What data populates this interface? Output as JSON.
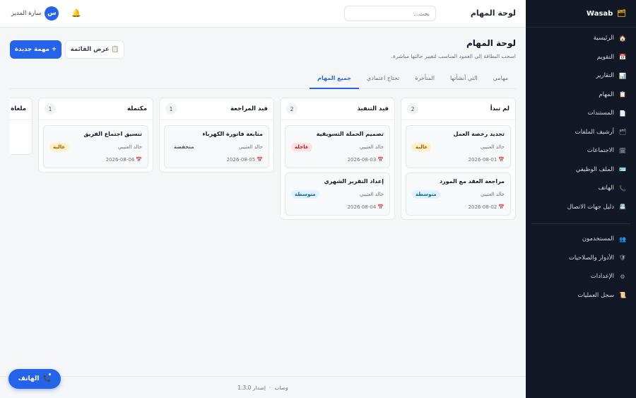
{
  "sidebar": {
    "brand": "Wasab",
    "brand_icon": "folder-icon",
    "items": [
      {
        "label": "الرئيسية",
        "icon": "🏠"
      },
      {
        "label": "التقويم",
        "icon": "📅"
      },
      {
        "label": "التقارير",
        "icon": "📊"
      },
      {
        "label": "المهام",
        "icon": "📋"
      },
      {
        "label": "المستندات",
        "icon": "📄"
      },
      {
        "label": "أرشيف الملفات",
        "icon": "🗂"
      },
      {
        "label": "الاجتماعات",
        "icon": "🗓"
      },
      {
        "label": "الملف الوظيفي",
        "icon": "🪪"
      },
      {
        "label": "الهاتف",
        "icon": "📞"
      },
      {
        "label": "دليل جهات الاتصال",
        "icon": "📇"
      }
    ],
    "admin_items": [
      {
        "label": "المستخدمون",
        "icon": "👥"
      },
      {
        "label": "الأدوار والصلاحيات",
        "icon": "🛡"
      },
      {
        "label": "الإعدادات",
        "icon": "⚙"
      },
      {
        "label": "سجل العمليات",
        "icon": "📜"
      }
    ]
  },
  "topbar": {
    "title": "لوحة المهام",
    "search_placeholder": "بحث...",
    "user_initial": "س",
    "user_name": "سارة المدير"
  },
  "header": {
    "title": "لوحة المهام",
    "subtitle": "اسحب البطاقة إلى العمود المناسب لتغيير حالتها مباشرة.",
    "new_task": "+ مهمة جديدة",
    "list_view": "📋 عرض القائمة"
  },
  "tabs": [
    "مهامي",
    "التي أنشأتها",
    "المتأخرة",
    "تحتاج اعتمادي",
    "جميع المهام"
  ],
  "active_tab": "جميع المهام",
  "columns": [
    {
      "title": "لم تبدأ",
      "count": "2",
      "cards": [
        {
          "title": "تجديد رخصة العمل",
          "assignee": "خالد العتيبي",
          "priority": "عالية",
          "level": "high",
          "date": "2026-08-01"
        },
        {
          "title": "مراجعة العقد مع المورد",
          "assignee": "خالد العتيبي",
          "priority": "متوسطة",
          "level": "medium",
          "date": "2026-08-02"
        }
      ]
    },
    {
      "title": "قيد التنفيذ",
      "count": "2",
      "cards": [
        {
          "title": "تصميم الحملة التسويقية",
          "assignee": "خالد العتيبي",
          "priority": "عاجلة",
          "level": "urgent",
          "date": "2026-08-03"
        },
        {
          "title": "إعداد التقرير الشهري",
          "assignee": "خالد العتيبي",
          "priority": "متوسطة",
          "level": "medium",
          "date": "2026-08-04"
        }
      ]
    },
    {
      "title": "قيد المراجعة",
      "count": "1",
      "cards": [
        {
          "title": "متابعة فاتورة الكهرباء",
          "assignee": "خالد العتيبي",
          "priority": "منخفضة",
          "level": "low",
          "date": "2026-08-05"
        }
      ]
    },
    {
      "title": "مكتملة",
      "count": "1",
      "cards": [
        {
          "title": "تنسيق اجتماع الفريق",
          "assignee": "خالد العتيبي",
          "priority": "عالية",
          "level": "high",
          "date": "2026-08-06"
        }
      ]
    },
    {
      "title": "ملغاة",
      "count": "",
      "cards": []
    }
  ],
  "footer": {
    "app": "وصاب",
    "separator": "·",
    "version": "إصدار 1.3.0"
  },
  "phone_fab": {
    "label": "الهاتف",
    "icon": "📞"
  },
  "colors": {
    "accent": "#2563eb",
    "sidebar_bg": "#121826"
  }
}
